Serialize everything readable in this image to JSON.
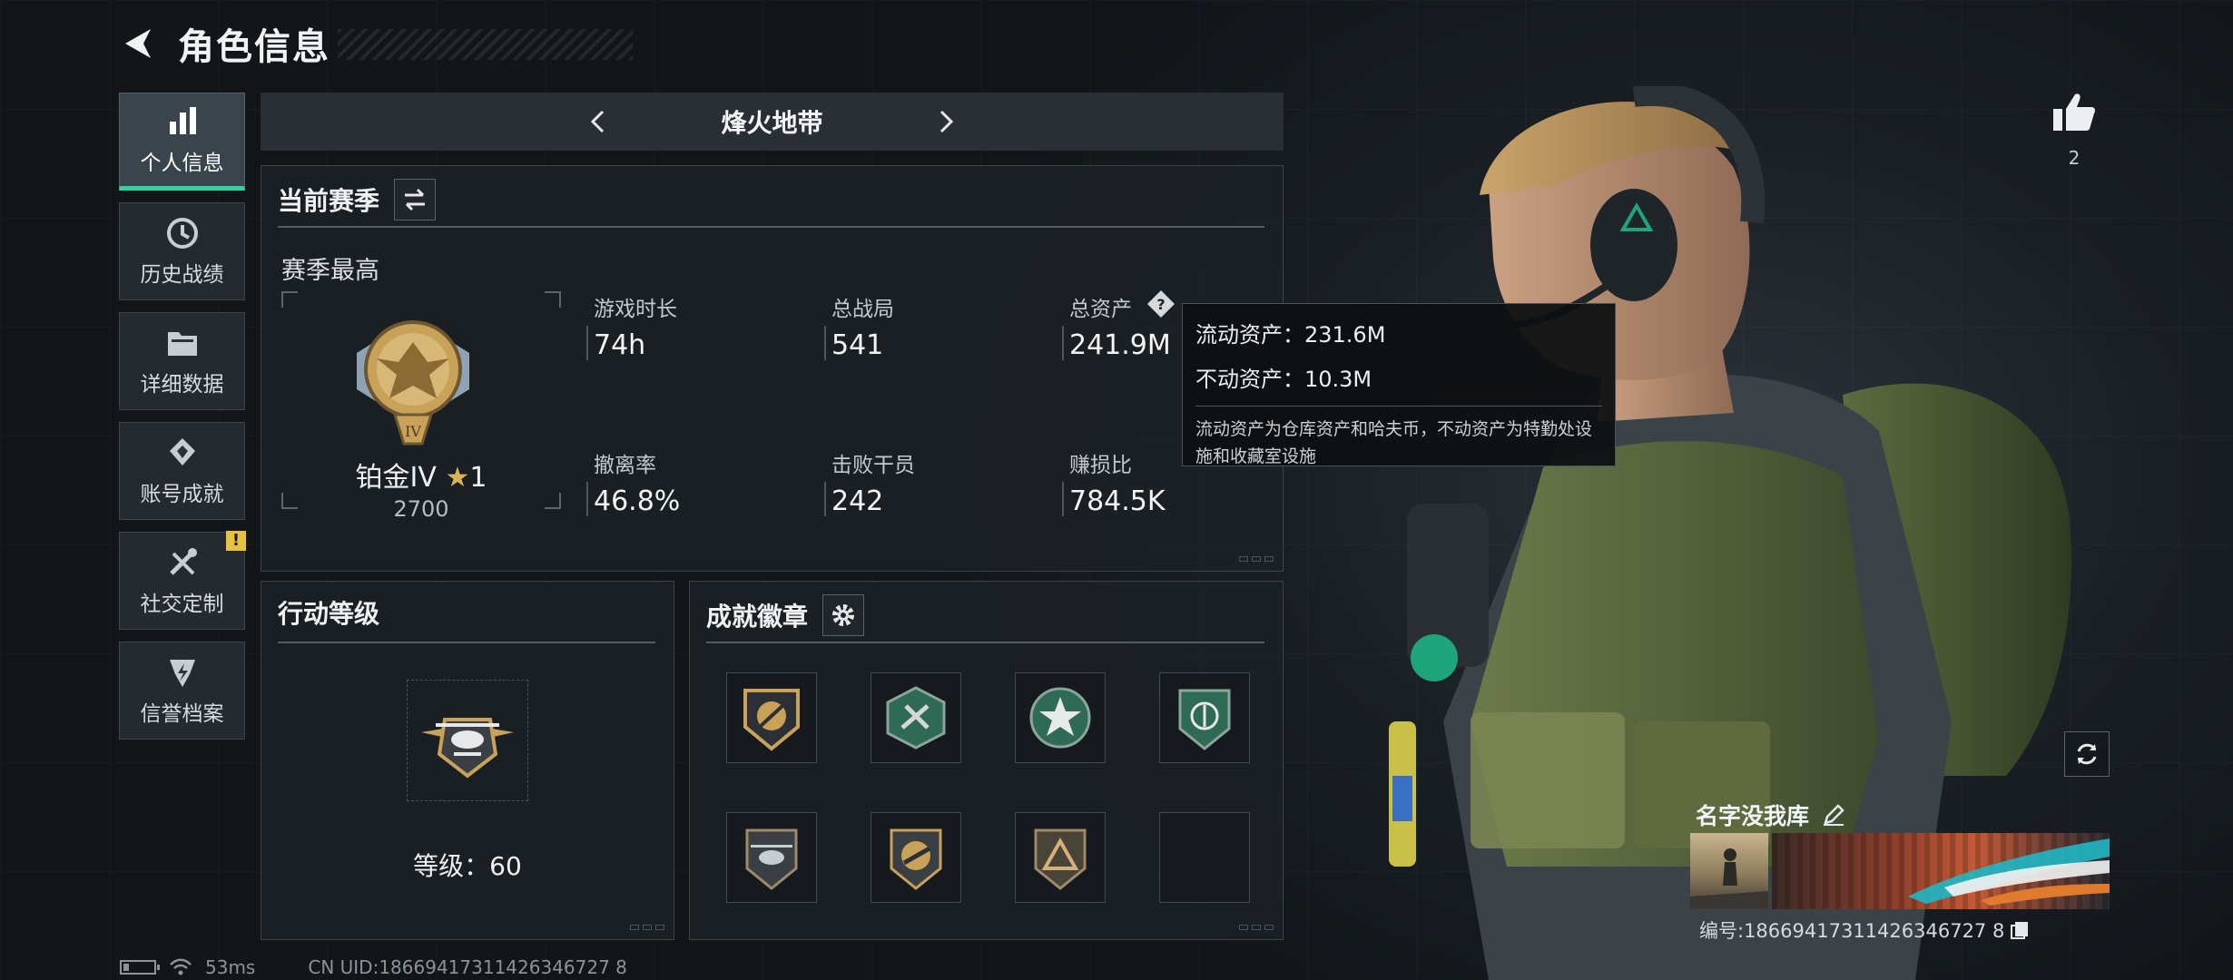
{
  "header": {
    "title": "角色信息"
  },
  "sidebar": {
    "items": [
      {
        "label": "个人信息",
        "icon": "bar-chart-icon",
        "active": true
      },
      {
        "label": "历史战绩",
        "icon": "history-icon"
      },
      {
        "label": "详细数据",
        "icon": "folder-icon"
      },
      {
        "label": "账号成就",
        "icon": "achievement-icon"
      },
      {
        "label": "社交定制",
        "icon": "tools-icon",
        "alert": "!"
      },
      {
        "label": "信誉档案",
        "icon": "reputation-icon"
      }
    ]
  },
  "mode_nav": {
    "title": "烽火地带"
  },
  "season": {
    "title": "当前赛季",
    "subtitle": "赛季最高",
    "rank_name": "铂金IV",
    "rank_stars": "1",
    "rank_score": "2700",
    "rank_emblem_mark": "IV",
    "stats": [
      {
        "label": "游戏时长",
        "value": "74h"
      },
      {
        "label": "总战局",
        "value": "541"
      },
      {
        "label": "总资产",
        "value": "241.9M"
      },
      {
        "label": "撤离率",
        "value": "46.8%"
      },
      {
        "label": "击败干员",
        "value": "242"
      },
      {
        "label": "赚损比",
        "value": "784.5K"
      }
    ]
  },
  "tooltip": {
    "liquid": "流动资产：231.6M",
    "fixed": "不动资产：10.3M",
    "desc": "流动资产为仓库资产和哈夫币，不动资产为特勤处设施和收藏室设施"
  },
  "action_level": {
    "title": "行动等级",
    "level_label": "等级：60"
  },
  "badges": {
    "title": "成就徽章",
    "slots": [
      "badge-1",
      "badge-2",
      "badge-3",
      "badge-4",
      "badge-5",
      "badge-6",
      "badge-7",
      "empty"
    ]
  },
  "profile": {
    "likes": "2",
    "name": "名字没我库",
    "id_text": "编号:18669417311426346727 8"
  },
  "footer": {
    "ping": "53ms",
    "uid": "CN UID:18669417311426346727 8"
  },
  "colors": {
    "accent": "#2fd2a0",
    "alert": "#e8c23a",
    "gold": "#c9a25a"
  }
}
